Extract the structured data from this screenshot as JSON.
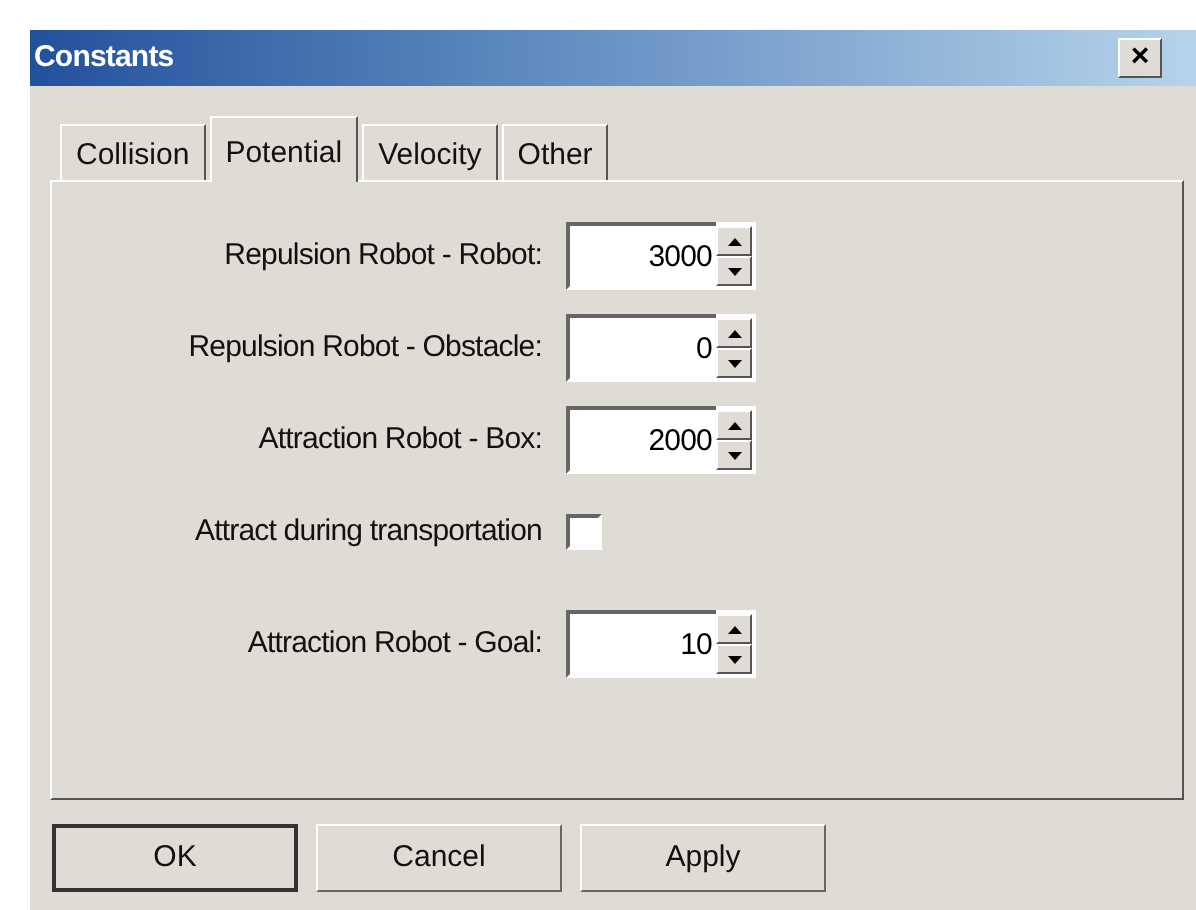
{
  "window": {
    "title": "Constants",
    "close": "×"
  },
  "tabs": [
    {
      "label": "Collision",
      "selected": false
    },
    {
      "label": "Potential",
      "selected": true
    },
    {
      "label": "Velocity",
      "selected": false
    },
    {
      "label": "Other",
      "selected": false
    }
  ],
  "fields": [
    {
      "kind": "spinner",
      "label": "Repulsion Robot - Robot:",
      "value": "3000"
    },
    {
      "kind": "spinner",
      "label": "Repulsion Robot - Obstacle:",
      "value": "0"
    },
    {
      "kind": "spinner",
      "label": "Attraction Robot - Box:",
      "value": "2000"
    },
    {
      "kind": "checkbox",
      "label": "Attract during transportation",
      "checked": false
    },
    {
      "kind": "spinner",
      "label": "Attraction Robot - Goal:",
      "value": "10"
    }
  ],
  "buttons": [
    {
      "label": "OK",
      "default": true
    },
    {
      "label": "Cancel",
      "default": false
    },
    {
      "label": "Apply",
      "default": false
    }
  ]
}
